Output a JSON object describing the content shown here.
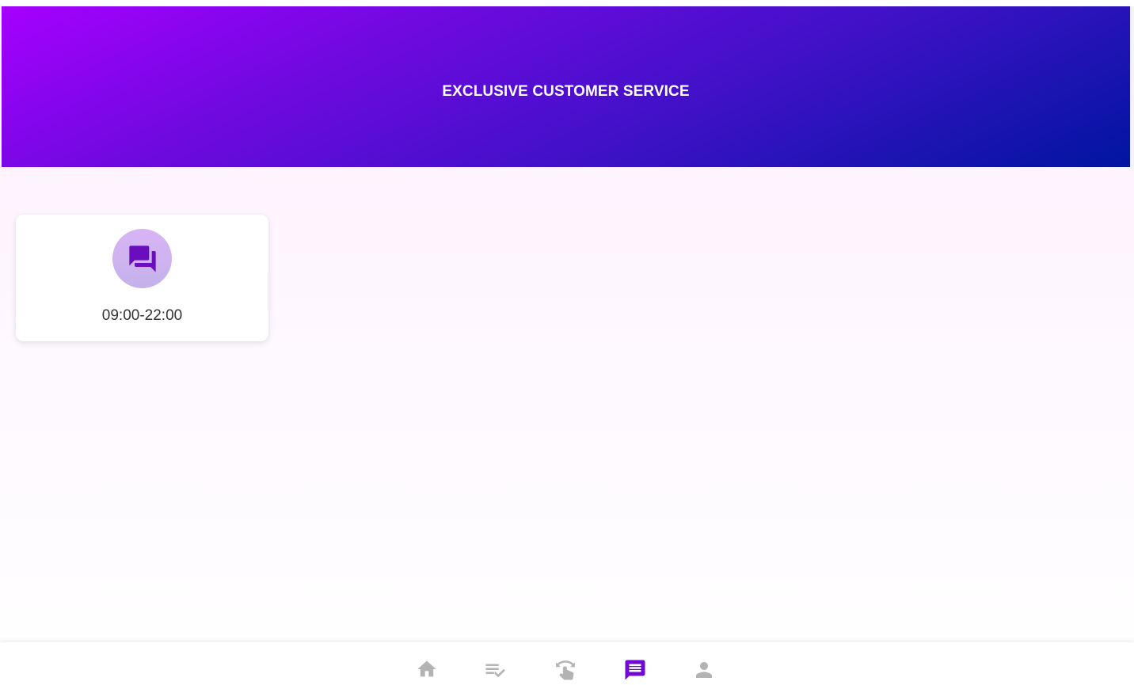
{
  "header": {
    "title": "EXCLUSIVE CUSTOMER SERVICE"
  },
  "service_card": {
    "icon": "chat-bubbles-icon",
    "hours": "09:00-22:00"
  },
  "bottom_nav": {
    "items": [
      {
        "icon": "home-icon",
        "active": false
      },
      {
        "icon": "task-list-icon",
        "active": false
      },
      {
        "icon": "swipe-touch-icon",
        "active": false
      },
      {
        "icon": "message-icon",
        "active": true
      },
      {
        "icon": "person-icon",
        "active": false
      }
    ]
  },
  "colors": {
    "header_gradient_start": "#a600ff",
    "header_gradient_end": "#0015a0",
    "accent": "#7208d4",
    "inactive_icon": "#b3b3b3",
    "page_background": "#fdf0ff"
  }
}
